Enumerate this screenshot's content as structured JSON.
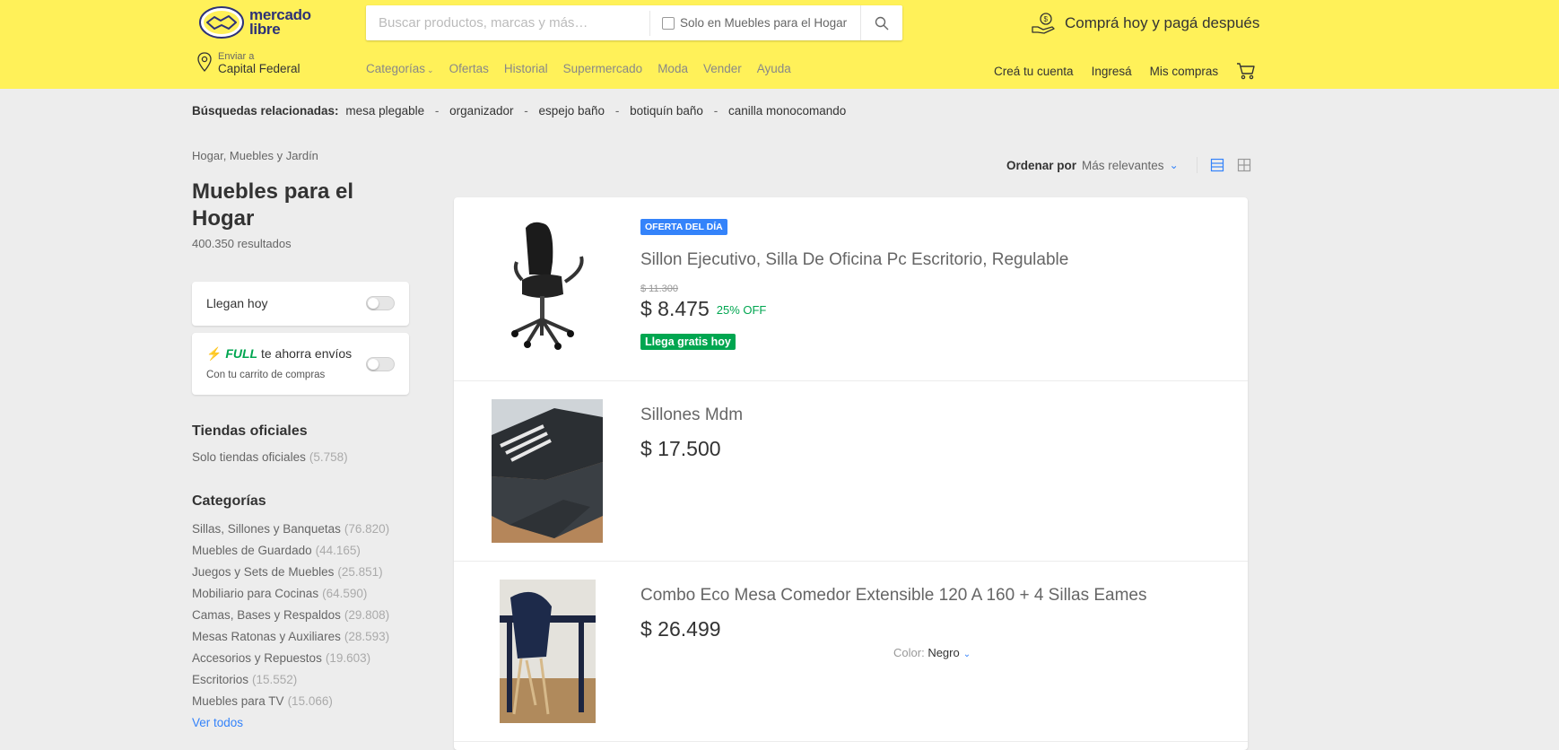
{
  "header": {
    "logo_line1": "mercado",
    "logo_line2": "libre",
    "search_placeholder": "Buscar productos, marcas y más…",
    "search_scope_label": "Solo en Muebles para el Hogar",
    "promo": "Comprá hoy y pagá después",
    "location_small": "Enviar a",
    "location_big": "Capital Federal",
    "nav": [
      "Categorías",
      "Ofertas",
      "Historial",
      "Supermercado",
      "Moda",
      "Vender",
      "Ayuda"
    ],
    "user_nav": [
      "Creá tu cuenta",
      "Ingresá",
      "Mis compras"
    ]
  },
  "related": {
    "label": "Búsquedas relacionadas:",
    "items": [
      "mesa plegable",
      "organizador",
      "espejo baño",
      "botiquín baño",
      "canilla monocomando"
    ]
  },
  "sidebar": {
    "breadcrumb": "Hogar, Muebles y Jardín",
    "title": "Muebles para el Hogar",
    "results": "400.350 resultados",
    "filter_today": "Llegan hoy",
    "full_tag": "FULL",
    "full_text": "te ahorra envíos",
    "full_sub": "Con tu carrito de compras",
    "official_title": "Tiendas oficiales",
    "official_link": "Solo tiendas oficiales",
    "official_count": "(5.758)",
    "categories_title": "Categorías",
    "categories": [
      {
        "label": "Sillas, Sillones y Banquetas",
        "count": "(76.820)"
      },
      {
        "label": "Muebles de Guardado",
        "count": "(44.165)"
      },
      {
        "label": "Juegos y Sets de Muebles",
        "count": "(25.851)"
      },
      {
        "label": "Mobiliario para Cocinas",
        "count": "(64.590)"
      },
      {
        "label": "Camas, Bases y Respaldos",
        "count": "(29.808)"
      },
      {
        "label": "Mesas Ratonas y Auxiliares",
        "count": "(28.593)"
      },
      {
        "label": "Accesorios y Repuestos",
        "count": "(19.603)"
      },
      {
        "label": "Escritorios",
        "count": "(15.552)"
      },
      {
        "label": "Muebles para TV",
        "count": "(15.066)"
      }
    ],
    "see_all": "Ver todos"
  },
  "sort": {
    "label": "Ordenar por",
    "value": "Más relevantes"
  },
  "items": [
    {
      "badge": "OFERTA DEL DÍA",
      "title": "Sillon Ejecutivo, Silla De Oficina Pc Escritorio, Regulable",
      "old_price": "$ 11.300",
      "price": "$ 8.475",
      "discount": "25% OFF",
      "shipping": "Llega gratis hoy"
    },
    {
      "title": "Sillones Mdm",
      "price": "$ 17.500"
    },
    {
      "title": "Combo Eco Mesa Comedor Extensible 120 A 160 + 4 Sillas Eames",
      "price": "$ 26.499",
      "color_label": "Color:",
      "color_value": "Negro"
    }
  ],
  "colors": {
    "header_bg": "#fff159",
    "accent_blue": "#3483fa",
    "green": "#00a650",
    "page_bg": "#ededed"
  }
}
